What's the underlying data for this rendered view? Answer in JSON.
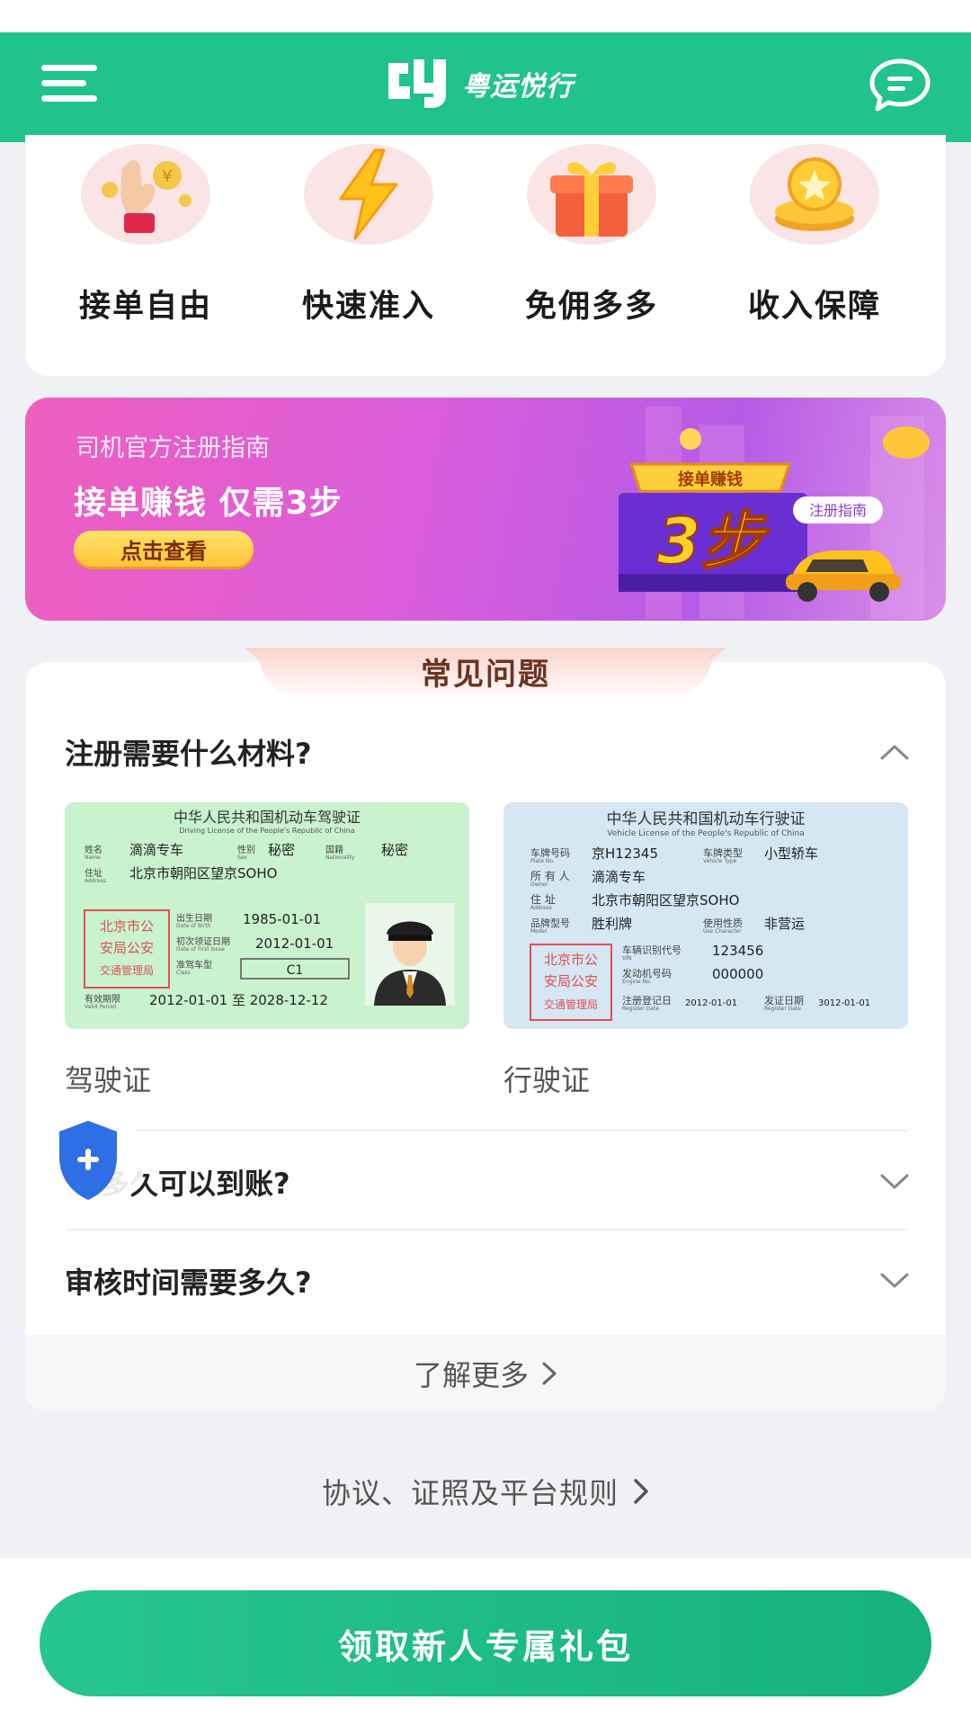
{
  "header": {
    "app_name": "粤运悦行",
    "menu_icon": "hamburger-menu-icon",
    "message_icon": "chat-bubble-icon"
  },
  "features": [
    {
      "label": "接单自由",
      "icon": "hand-coin-icon"
    },
    {
      "label": "快速准入",
      "icon": "lightning-icon"
    },
    {
      "label": "免佣多多",
      "icon": "gift-box-icon"
    },
    {
      "label": "收入保障",
      "icon": "coin-stack-icon"
    }
  ],
  "banner": {
    "subtitle": "司机官方注册指南",
    "title": "接单赚钱 仅需3步",
    "button": "点击查看",
    "art_top_label": "接单赚钱",
    "art_main_text": "3步",
    "art_tag": "注册指南"
  },
  "faq": {
    "title": "常见问题",
    "items": [
      {
        "question": "注册需要什么材料?",
        "expanded": true
      },
      {
        "question": "多久可以到账?",
        "expanded": false
      },
      {
        "question": "审核时间需要多久?",
        "expanded": false
      }
    ],
    "driving_license": {
      "title": "中华人民共和国机动车驾驶证",
      "subtitle": "Driving License of the People's Republic of China",
      "name_label": "姓名",
      "name_label_en": "Name",
      "name": "滴滴专车",
      "sex_label": "性别",
      "sex_label_en": "Sex",
      "sex": "秘密",
      "nationality_label": "国籍",
      "nationality_label_en": "Nationality",
      "nationality": "秘密",
      "address_label": "住址",
      "address_label_en": "Address",
      "address": "北京市朝阳区望京SOHO",
      "stamp": [
        "北京市公",
        "安局公安",
        "交通管理局"
      ],
      "dob_label": "出生日期",
      "dob_label_en": "Date of Birth",
      "dob": "1985-01-01",
      "issue_label": "初次领证日期",
      "issue_label_en": "Date of First Issue",
      "issue": "2012-01-01",
      "class_label": "准驾车型",
      "class_label_en": "Class",
      "class": "C1",
      "valid_label": "有效期限",
      "valid_label_en": "Valid Period",
      "valid": "2012-01-01 至 2028-12-12"
    },
    "vehicle_license": {
      "title": "中华人民共和国机动车行驶证",
      "subtitle": "Vehicle License of the People's Republic of China",
      "plate_label": "车牌号码",
      "plate_label_en": "Plate No.",
      "plate": "京H12345",
      "type_label": "车牌类型",
      "type_label_en": "Vehicle Type",
      "type": "小型轿车",
      "owner_label": "所 有 人",
      "owner_label_en": "Owner",
      "owner": "滴滴专车",
      "address_label": "住    址",
      "address_label_en": "Address",
      "address": "北京市朝阳区望京SOHO",
      "model_label": "品牌型号",
      "model_label_en": "Model",
      "model": "胜利牌",
      "use_label": "使用性质",
      "use_label_en": "Use Character",
      "use": "非营运",
      "stamp": [
        "北京市公",
        "安局公安",
        "交通管理局"
      ],
      "vin_label": "车辆识别代号",
      "vin_label_en": "VIN",
      "vin": "123456",
      "engine_label": "发动机号码",
      "engine_label_en": "Engine No.",
      "engine": "000000",
      "reg_label": "注册登记日",
      "reg_label_en": "Register Date",
      "reg": "2012-01-01",
      "issue_label": "发证日期",
      "issue_label_en": "Register Date",
      "issue": "3012-01-01"
    },
    "driving_caption": "驾驶证",
    "vehicle_caption": "行驶证",
    "more": "了解更多"
  },
  "floating_icon": "shield-plus-icon",
  "rules_link": "协议、证照及平台规则",
  "cta_button": "领取新人专属礼包",
  "colors": {
    "brand_green": "#20c28e",
    "cta_green": "#15b27e",
    "banner_pink": "#ef5fbf",
    "banner_purple": "#b65be6",
    "faq_title_brown": "#6b3420"
  }
}
